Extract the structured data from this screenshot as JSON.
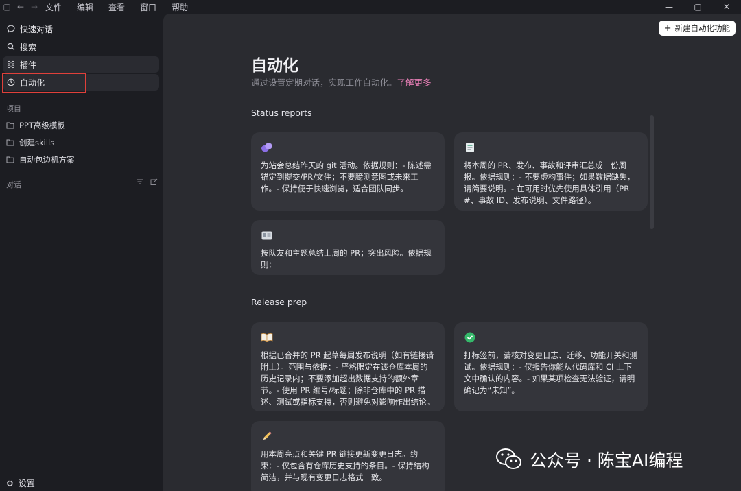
{
  "menu": [
    "文件",
    "编辑",
    "查看",
    "窗口",
    "帮助"
  ],
  "sidebar": {
    "nav": [
      {
        "label": "快速对话",
        "icon": "chat-bubble-icon"
      },
      {
        "label": "搜索",
        "icon": "search-icon"
      },
      {
        "label": "插件",
        "icon": "plugin-grid-icon"
      },
      {
        "label": "自动化",
        "icon": "clock-icon"
      }
    ],
    "projects_label": "项目",
    "projects": [
      "PPT高级模板",
      "创建skills",
      "自动包边机方案"
    ],
    "chats_label": "对话",
    "settings_label": "设置"
  },
  "header": {
    "new_button": "新建自动化功能",
    "title": "自动化",
    "subtitle": "通过设置定期对话，实现工作自动化。",
    "learn_more": "了解更多"
  },
  "groups": [
    {
      "title": "Status reports",
      "cards": [
        {
          "icon": "purple-blob-icon",
          "text": "为站会总结昨天的 git 活动。依据规则：- 陈述需锚定到提交/PR/文件；不要臆测意图或未来工作。- 保持便于快速浏览，适合团队同步。"
        },
        {
          "icon": "document-icon",
          "text": "将本周的 PR、发布、事故和评审汇总成一份周报。依据规则：- 不要虚构事件；如果数据缺失，请简要说明。- 在可用时优先使用具体引用（PR #、事故 ID、发布说明、文件路径）。"
        },
        {
          "icon": "id-card-icon",
          "text": "按队友和主题总结上周的 PR；突出风险。依据规则："
        }
      ]
    },
    {
      "title": "Release prep",
      "cards": [
        {
          "icon": "open-book-icon",
          "text": "根据已合并的 PR 起草每周发布说明（如有链接请附上）。范围与依据：- 严格限定在该仓库本周的历史记录内；不要添加超出数据支持的额外章节。- 使用 PR 编号/标题；除非仓库中的 PR 描述、测试或指标支持，否则避免对影响作出结论。"
        },
        {
          "icon": "check-circle-icon",
          "text": "打标签前，请核对变更日志、迁移、功能开关和测试。依据规则：- 仅报告你能从代码库和 CI 上下文中确认的内容。- 如果某项检查无法验证，请明确记为“未知”。"
        },
        {
          "icon": "pencil-icon",
          "text": "用本周亮点和关键 PR 链接更新变更日志。约束：- 仅包含有仓库历史支持的条目。- 保持结构简洁，并与现有变更日志格式一致。"
        }
      ]
    }
  ],
  "watermark": "公众号 · 陈宝AI编程"
}
